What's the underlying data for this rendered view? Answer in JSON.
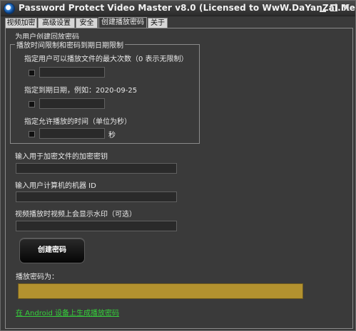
{
  "window": {
    "title": "Password Protect Video Master v8.0 (Licensed to WwW.DaYanZai.Me)",
    "controls": {
      "minimize": "minimize",
      "maximize": "maximize",
      "close": "X"
    }
  },
  "tabs": [
    {
      "label": "视频加密"
    },
    {
      "label": "高级设置"
    },
    {
      "label": "安全"
    },
    {
      "label": "创建播放密码",
      "active": true
    },
    {
      "label": "关于"
    }
  ],
  "panel": {
    "heading": "为用户创建回放密码",
    "group": {
      "title": "播放时间限制和密码到期日期限制",
      "max_plays_label": "指定用户可以播放文件的最大次数（0 表示无限制）",
      "max_plays_value": "",
      "expiry_label": "指定到期日期，例如：2020-09-25",
      "expiry_value": "",
      "duration_label": "指定允许播放的时间（单位为秒）",
      "duration_value": "",
      "duration_unit": "秒"
    },
    "encryption_key_label": "输入用于加密文件的加密密钥",
    "encryption_key_value": "",
    "machine_id_label": "输入用户计算机的机器 ID",
    "machine_id_value": "",
    "watermark_label": "视频播放时视频上会显示水印（可选）",
    "watermark_value": "",
    "create_button": "创建密码",
    "password_label": "播放密码为：",
    "password_value": "",
    "android_link": "在 Android 设备上生成播放密码"
  },
  "colors": {
    "window_bg": "#3a3a3a",
    "password_field": "#b3922f",
    "link": "#35d13b"
  }
}
